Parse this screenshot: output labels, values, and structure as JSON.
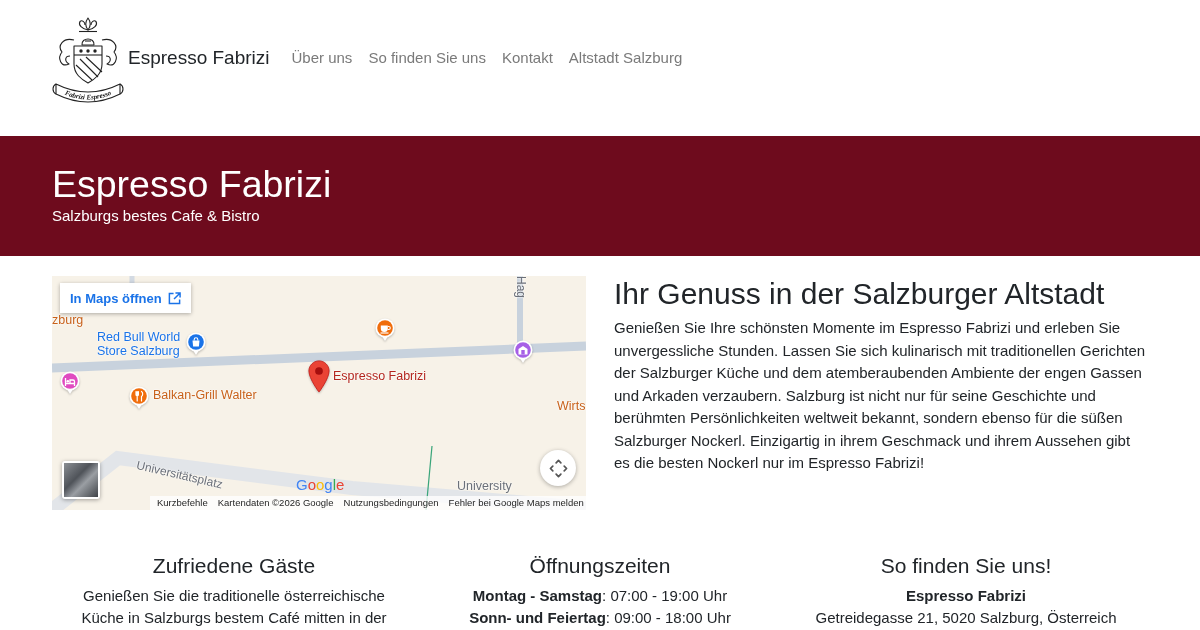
{
  "header": {
    "logo_text": "Fabrizi Espresso",
    "brand": "Espresso Fabrizi",
    "nav": [
      "Über uns",
      "So finden Sie uns",
      "Kontakt",
      "Altstadt Salzburg"
    ]
  },
  "hero": {
    "title": "Espresso Fabrizi",
    "subtitle": "Salzburgs bestes Cafe & Bistro"
  },
  "map": {
    "open_link": "In Maps öffnen",
    "places": [
      {
        "kind": "street",
        "label": "Hag"
      },
      {
        "kind": "eatery",
        "label": "zburg"
      },
      {
        "kind": "shop",
        "label": "Red Bull World Store Salzburg"
      },
      {
        "kind": "cafe"
      },
      {
        "kind": "museum"
      },
      {
        "kind": "hotel"
      },
      {
        "kind": "pin",
        "label": "Espresso Fabrizi"
      },
      {
        "kind": "restaurant",
        "label": "Balkan-Grill Walter"
      },
      {
        "kind": "eatery",
        "label": "Wirts"
      },
      {
        "kind": "street",
        "label": "Universitätsplatz"
      },
      {
        "kind": "district",
        "label": "University"
      }
    ],
    "google_logo": "Google",
    "attribution": [
      "Kurzbefehle",
      "Kartendaten ©2026 Google",
      "Nutzungsbedingungen",
      "Fehler bei Google Maps melden"
    ]
  },
  "intro": {
    "heading": "Ihr Genuss in der Salzburger Altstadt",
    "text": "Genießen Sie Ihre schönsten Momente im Espresso Fabrizi und erleben Sie unvergessliche Stunden. Lassen Sie sich kulinarisch mit traditionellen Gerichten der Salzburger Küche und dem atemberaubenden Ambiente der engen Gassen und Arkaden verzaubern. Salzburg ist nicht nur für seine Geschichte und berühmten Persönlichkeiten weltweit bekannt, sondern ebenso für die süßen Salzburger Nockerl. Einzigartig in ihrem Geschmack und ihrem Aussehen gibt es die besten Nockerl nur im Espresso Fabrizi!"
  },
  "footer": {
    "guests": {
      "heading": "Zufriedene Gäste",
      "text": "Genießen Sie die traditionelle österreichische Küche in Salzburgs bestem Café mitten in der"
    },
    "hours": {
      "heading": "Öffnungszeiten",
      "lines": [
        "**Montag - Samstag**: 07:00 - 19:00 Uhr",
        "**Sonn- und Feiertag**: 09:00 - 18:00 Uhr"
      ]
    },
    "location": {
      "heading": "So finden Sie uns!",
      "name": "Espresso Fabrizi",
      "address": "Getreidegasse 21, 5020 Salzburg, Österreich"
    }
  }
}
